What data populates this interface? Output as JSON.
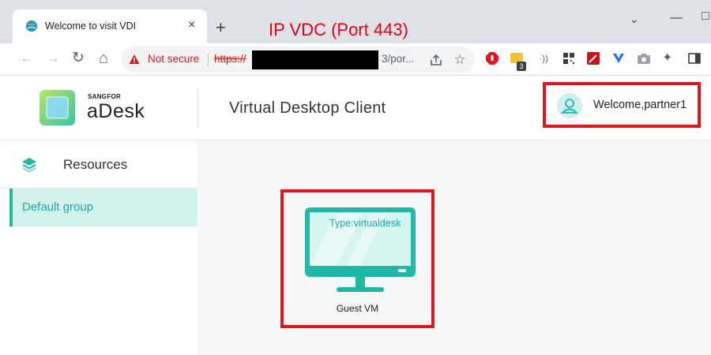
{
  "browser": {
    "tab_title": "Welcome to visit VDI",
    "tab_close": "×",
    "new_tab": "+",
    "annotation_title": "IP VDC (Port 443)",
    "security_label": "Not secure",
    "url_scheme": "https://",
    "url_rest": "3/por...",
    "extension_badge": "3",
    "nav": {
      "back": "←",
      "forward": "→",
      "reload": "↻",
      "home": "⌂"
    }
  },
  "header": {
    "brand_small": "SANGFOR",
    "brand_name": "aDesk",
    "page_title": "Virtual Desktop Client",
    "welcome": "Welcome,partner1"
  },
  "sidebar": {
    "resources_label": "Resources",
    "groups": [
      {
        "label": "Default group"
      }
    ]
  },
  "vms": [
    {
      "type_label": "Type:virtualdesk",
      "name": "Guest VM"
    }
  ],
  "colors": {
    "accent": "#1fb7a6",
    "annotation_red": "#e0161f",
    "sidebar_selected_bg": "#d2f2ec"
  },
  "icons": [
    "globe-favicon-icon",
    "warning-icon",
    "share-icon",
    "star-icon",
    "layers-icon",
    "user-icon",
    "monitor-icon"
  ]
}
